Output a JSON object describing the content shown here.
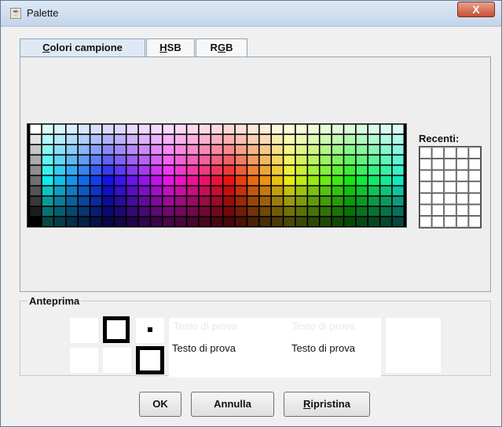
{
  "window": {
    "title": "Palette",
    "close_glyph": "X"
  },
  "tabs": [
    {
      "label": "Colori campione",
      "mnemonic": "C",
      "active": true
    },
    {
      "label": "HSB",
      "mnemonic": "H",
      "active": false
    },
    {
      "label": "RGB",
      "mnemonic": "G",
      "active": false
    }
  ],
  "swatches_panel": {
    "recent_label": "Recenti:"
  },
  "preview": {
    "label": "Anteprima",
    "samples": [
      {
        "text": "Testo di prova"
      },
      {
        "text": "Testo di prova"
      },
      {
        "text": "Testo di prova"
      },
      {
        "text": "Testo di prova"
      }
    ]
  },
  "buttons": {
    "ok": "OK",
    "cancel": "Annulla",
    "reset": "Ripristina",
    "reset_mnemonic": "R"
  }
}
